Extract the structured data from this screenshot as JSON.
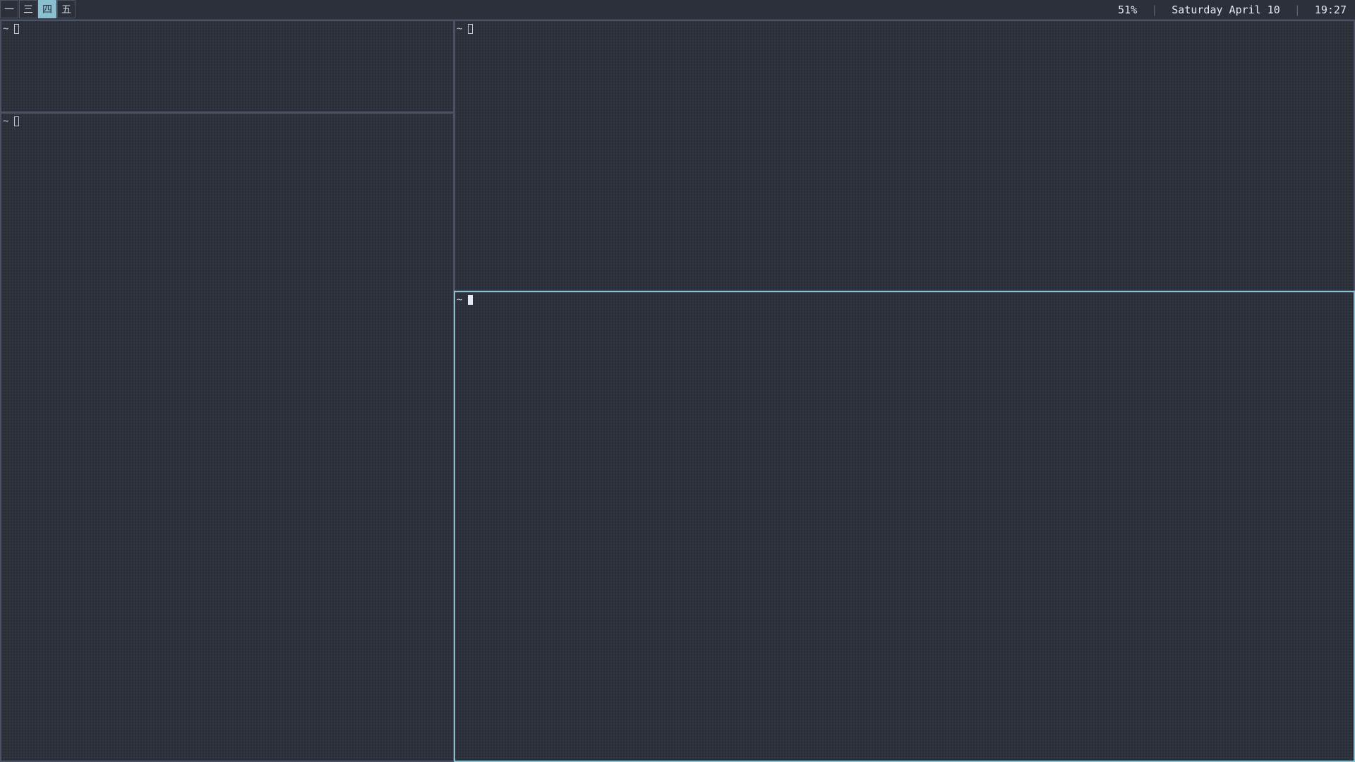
{
  "workspaces": [
    {
      "label": "一",
      "active": false
    },
    {
      "label": "三",
      "active": false
    },
    {
      "label": "四",
      "active": true
    },
    {
      "label": "五",
      "active": false
    }
  ],
  "status": {
    "battery": "51%",
    "separator": "|",
    "date": "Saturday April 10",
    "time": "19:27"
  },
  "panes": [
    {
      "prompt": "~"
    },
    {
      "prompt": "~"
    },
    {
      "prompt": "~"
    },
    {
      "prompt": "~"
    }
  ],
  "colors": {
    "background": "#2c313c",
    "bar": "#2b303b",
    "border": "#4a5263",
    "focus_border": "#88c0d0",
    "active_workspace": "#88c0d0",
    "text": "#d8dee9"
  }
}
